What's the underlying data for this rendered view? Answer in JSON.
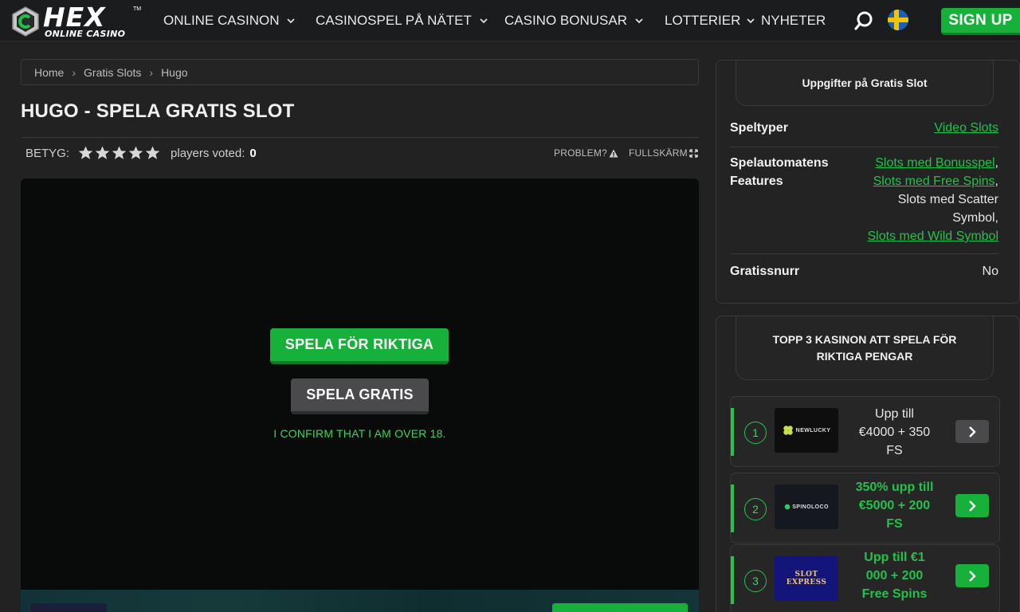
{
  "header": {
    "logo_word": "HEX",
    "logo_sub": "ONLINE CASINO",
    "logo_tm": "TM",
    "nav": [
      {
        "label": "ONLINE CASINON",
        "has_dropdown": true
      },
      {
        "label": "CASINOSPEL PÅ NÄTET",
        "has_dropdown": true
      },
      {
        "label": "CASINO BONUSAR",
        "has_dropdown": true
      },
      {
        "label": "LOTTERIER",
        "has_dropdown": true
      },
      {
        "label": "NYHETER",
        "has_dropdown": false
      }
    ],
    "search_icon": "search-icon",
    "language_flag": "sweden-flag",
    "signup_label": "SIGN UP"
  },
  "breadcrumb": [
    "Home",
    "Gratis Slots",
    "Hugo"
  ],
  "page_title": "HUGO - SPELA GRATIS SLOT",
  "rating": {
    "label": "BETYG:",
    "stars": 5,
    "voted_label": "players voted:",
    "voted_count": "0"
  },
  "tools": {
    "problem_label": "PROBLEM?",
    "fullscreen_label": "FULLSKÄRM"
  },
  "game": {
    "play_real_label": "SPELA FÖR RIKTIGA",
    "play_free_label": "SPELA GRATIS",
    "confirm_text": "I CONFIRM THAT I AM OVER 18."
  },
  "details_panel": {
    "title": "Uppgifter på Gratis Slot",
    "rows": [
      {
        "key": "Speltyper",
        "values": [
          {
            "text": "Video Slots",
            "link": true
          }
        ]
      },
      {
        "key_lines": [
          "Spelautomatens",
          "Features"
        ],
        "values": [
          {
            "text": "Slots med Bonusspel",
            "link": true,
            "suffix": ","
          },
          {
            "text": "Slots med Free Spins",
            "link": true,
            "suffix": ","
          },
          {
            "text": "Slots med Scatter",
            "link": false
          },
          {
            "text": "Symbol,",
            "link": false
          },
          {
            "text": "Slots med Wild Symbol",
            "link": true
          }
        ]
      },
      {
        "key": "Gratissnurr",
        "values": [
          {
            "text": "No",
            "link": false
          }
        ]
      }
    ]
  },
  "top_panel": {
    "title_lines": [
      "TOPP 3 KASINON ATT SPELA FÖR",
      "RIKTIGA PENGAR"
    ],
    "casinos": [
      {
        "rank": "1",
        "logo_text": "NEWLUCKY",
        "offer_lines": [
          "Upp till",
          "€4000 + 350",
          "FS"
        ],
        "offer_color": "#e6e6e6",
        "button_color": "#4a4a4c"
      },
      {
        "rank": "2",
        "logo_text": "SPINOLOCO",
        "offer_lines": [
          "350% upp till",
          "€5000 + 200",
          "FS"
        ],
        "offer_color": "#21c24a",
        "button_color": "#17b03a"
      },
      {
        "rank": "3",
        "logo_text": "SLOT EXPRESS",
        "offer_lines": [
          "Upp till €1",
          "000 + 200",
          "Free Spins"
        ],
        "offer_color": "#21c24a",
        "button_color": "#17b03a"
      }
    ]
  },
  "colors": {
    "accent_green": "#17b03a",
    "link_green": "#21c24a",
    "background": "#222223"
  }
}
